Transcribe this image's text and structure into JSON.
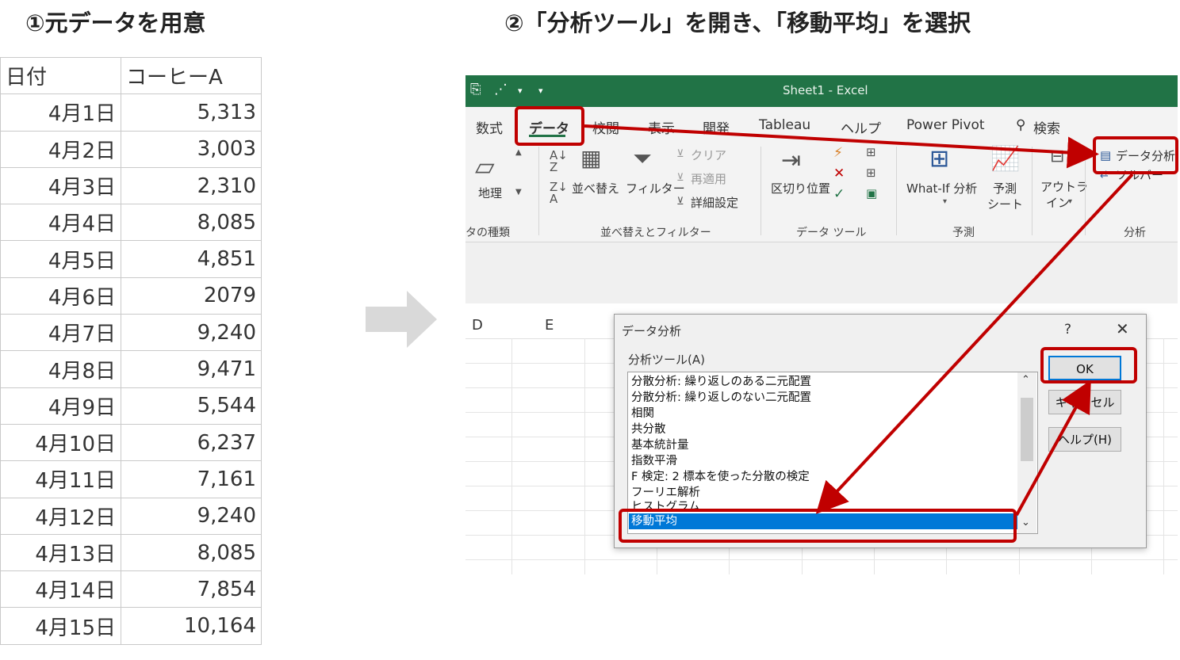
{
  "headings": {
    "step1": "①元データを用意",
    "step2": "②「分析ツール」を開き、「移動平均」を選択"
  },
  "source_table": {
    "headers": [
      "日付",
      "コーヒーA"
    ],
    "rows": [
      [
        "4月1日",
        "5,313"
      ],
      [
        "4月2日",
        "3,003"
      ],
      [
        "4月3日",
        "2,310"
      ],
      [
        "4月4日",
        "8,085"
      ],
      [
        "4月5日",
        "4,851"
      ],
      [
        "4月6日",
        "2079"
      ],
      [
        "4月7日",
        "9,240"
      ],
      [
        "4月8日",
        "9,471"
      ],
      [
        "4月9日",
        "5,544"
      ],
      [
        "4月10日",
        "6,237"
      ],
      [
        "4月11日",
        "7,161"
      ],
      [
        "4月12日",
        "9,240"
      ],
      [
        "4月13日",
        "8,085"
      ],
      [
        "4月14日",
        "7,854"
      ],
      [
        "4月15日",
        "10,164"
      ]
    ]
  },
  "excel": {
    "window_title": "Sheet1  -  Excel",
    "tabs": [
      "数式",
      "データ",
      "校閲",
      "表示",
      "開発",
      "Tableau",
      "ヘルプ",
      "Power Pivot",
      "検索"
    ],
    "active_tab": "データ",
    "ribbon": {
      "geo_label": "地理",
      "data_types_group": "タの種類",
      "sort_label": "並べ替え",
      "filter_label": "フィルター",
      "clear_label": "クリア",
      "reapply_label": "再適用",
      "advanced_label": "詳細設定",
      "sort_filter_group": "並べ替えとフィルター",
      "text_to_columns_label": "区切り位置",
      "data_tools_group": "データ ツール",
      "whatif_label": "What-If 分析",
      "forecast_sheet_label1": "予測",
      "forecast_sheet_label2": "シート",
      "forecast_group": "予測",
      "outline_label1": "アウトラ",
      "outline_label2": "イン",
      "data_analysis_label": "データ分析",
      "solver_label": "ソルバー",
      "analysis_group": "分析"
    },
    "columns": [
      "D",
      "E"
    ]
  },
  "dialog": {
    "title": "データ分析",
    "help_mark": "?",
    "tools_label": "分析ツール(A)",
    "items": [
      "分散分析: 繰り返しのある二元配置",
      "分散分析: 繰り返しのない二元配置",
      "相関",
      "共分散",
      "基本統計量",
      "指数平滑",
      "F 検定: 2 標本を使った分散の検定",
      "フーリエ解析",
      "ヒストグラム",
      "移動平均"
    ],
    "selected": "移動平均",
    "buttons": {
      "ok": "OK",
      "cancel": "キャンセル",
      "help": "ヘルプ(H)"
    }
  },
  "colors": {
    "excel_green": "#217346",
    "highlight_red": "#c00000",
    "selection_blue": "#0078d7"
  }
}
